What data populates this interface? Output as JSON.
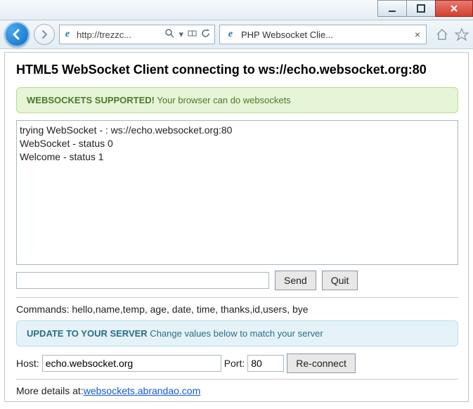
{
  "browser": {
    "url": "http://trezzc...",
    "tab_title": "PHP Websocket Clie..."
  },
  "page": {
    "heading": "HTML5 WebSocket Client connecting to ws://echo.websocket.org:80",
    "support_banner_strong": "WEBSOCKETS SUPPORTED!",
    "support_banner_rest": " Your browser can do websockets",
    "log_lines": {
      "l0": "trying WebSocket - : ws://echo.websocket.org:80",
      "l1": "WebSocket - status 0",
      "l2": "Welcome - status 1"
    },
    "send_label": "Send",
    "quit_label": "Quit",
    "commands_text": "Commands: hello,name,temp, age, date, time, thanks,id,users, bye",
    "update_banner_strong": "UPDATE TO YOUR SERVER",
    "update_banner_rest": " Change values below to match your server",
    "host_label": "Host:",
    "host_value": "echo.websocket.org",
    "port_label": "Port:",
    "port_value": "80",
    "reconnect_label": "Re-connect",
    "more_prefix": "More details at:",
    "more_link": "websockets.abrandao.com"
  }
}
